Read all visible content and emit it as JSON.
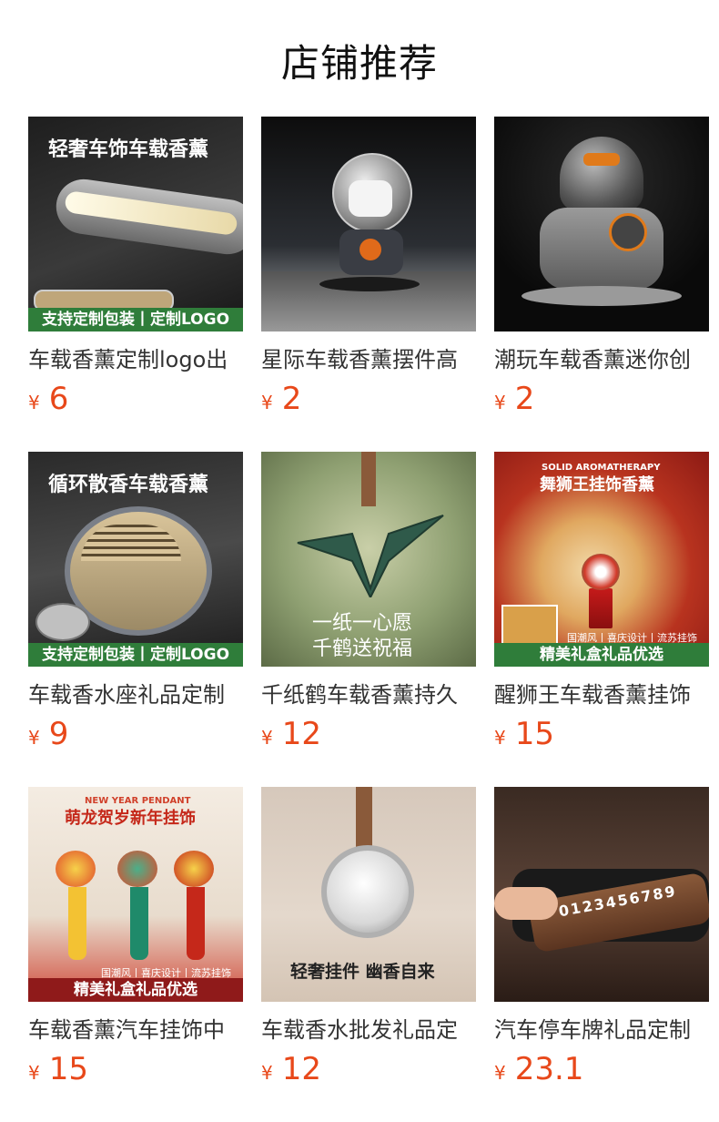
{
  "header": {
    "title": "店铺推荐"
  },
  "products": [
    {
      "name": "车载香薰定制logo出",
      "currency": "¥",
      "price": "6",
      "img_headline": "轻奢车饰车载香薰",
      "img_strip": "支持定制包装丨定制LOGO",
      "img_small": ""
    },
    {
      "name": "星际车载香薰摆件高",
      "currency": "¥",
      "price": "2",
      "img_headline": "",
      "img_strip": "",
      "img_small": ""
    },
    {
      "name": "潮玩车载香薰迷你创",
      "currency": "¥",
      "price": "2",
      "img_headline": "",
      "img_strip": "",
      "img_small": ""
    },
    {
      "name": "车载香水座礼品定制",
      "currency": "¥",
      "price": "9",
      "img_headline": "循环散香车载香薰",
      "img_strip": "支持定制包装丨定制LOGO",
      "img_small": ""
    },
    {
      "name": "千纸鹤车载香薰持久",
      "currency": "¥",
      "price": "12",
      "img_headline": "一纸一心愿",
      "img_strip": "千鹤送祝福",
      "img_small": ""
    },
    {
      "name": "醒狮王车载香薰挂饰",
      "currency": "¥",
      "price": "15",
      "img_headline": "舞狮王挂饰香薰",
      "img_strip": "精美礼盒礼品优选",
      "img_small": "SOLID AROMATHERAPY",
      "img_tags": "国潮风丨喜庆设计丨流苏挂饰"
    },
    {
      "name": "车载香薰汽车挂饰中",
      "currency": "¥",
      "price": "15",
      "img_headline": "萌龙贺岁新年挂饰",
      "img_strip": "精美礼盒礼品优选",
      "img_small": "NEW YEAR PENDANT",
      "img_tags": "国潮风丨喜庆设计丨流苏挂饰"
    },
    {
      "name": "车载香水批发礼品定",
      "currency": "¥",
      "price": "12",
      "img_headline": "轻奢挂件 幽香自来",
      "img_strip": "",
      "img_small": ""
    },
    {
      "name": "汽车停车牌礼品定制",
      "currency": "¥",
      "price": "23.1",
      "img_headline": "",
      "img_strip": "",
      "img_small": "0123456789"
    }
  ],
  "colors": {
    "price": "#e8481a",
    "text": "#333333",
    "strip_green": "#2f7d3a",
    "strip_red": "#8f1a1a"
  }
}
